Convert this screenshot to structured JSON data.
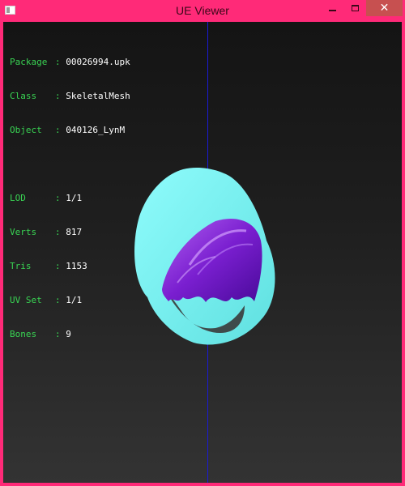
{
  "window": {
    "title": "UE Viewer",
    "close_glyph": "✕",
    "accent_color": "#ff2a78",
    "close_color": "#c75050"
  },
  "info": {
    "package_label": "Package",
    "package_value": "00026994.upk",
    "class_label": "Class",
    "class_value": "SkeletalMesh",
    "object_label": "Object",
    "object_value": "040126_LynM",
    "lod_label": "LOD",
    "lod_value": "1/1",
    "verts_label": "Verts",
    "verts_value": "817",
    "tris_label": "Tris",
    "tris_value": "1153",
    "uvset_label": "UV Set",
    "uvset_value": "1/1",
    "bones_label": "Bones",
    "bones_value": "9",
    "separator": ":",
    "label_color": "#39d353",
    "value_color": "#ffffff"
  },
  "viewport": {
    "axis_color": "#1a1ad8",
    "mesh_outer_color": "#7ff4f4",
    "mesh_inner_color": "#6ad8d8",
    "hair_color": "#8a2be2"
  }
}
